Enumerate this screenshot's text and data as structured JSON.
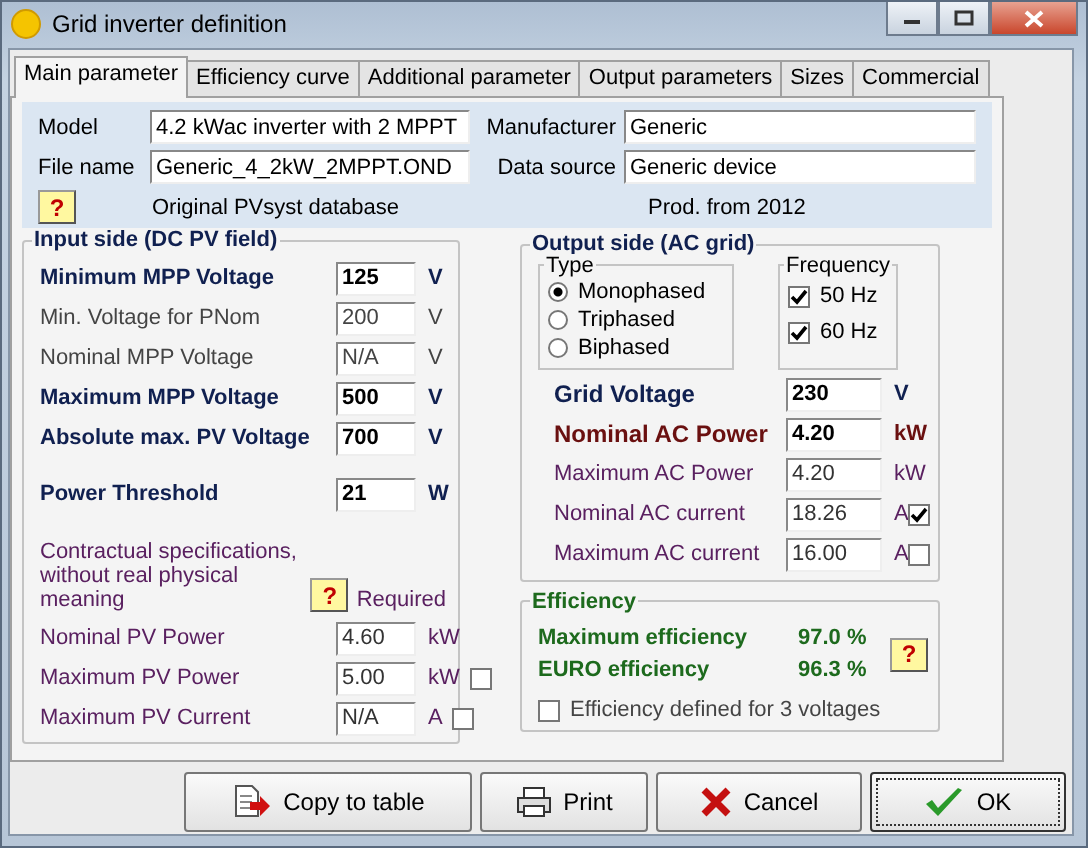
{
  "window": {
    "title": "Grid inverter definition"
  },
  "tabs": [
    {
      "label": "Main parameter",
      "selected": true
    },
    {
      "label": "Efficiency curve",
      "selected": false
    },
    {
      "label": "Additional parameter",
      "selected": false
    },
    {
      "label": "Output parameters",
      "selected": false
    },
    {
      "label": "Sizes",
      "selected": false
    },
    {
      "label": "Commercial",
      "selected": false
    }
  ],
  "general": {
    "left_fields": [
      {
        "label": "Model",
        "value": "4.2 kWac inverter with 2 MPPT"
      },
      {
        "label": "File name",
        "value": "Generic_4_2kW_2MPPT.OND"
      }
    ],
    "right_fields": [
      {
        "label": "Manufacturer",
        "value": "Generic"
      },
      {
        "label": "Data source",
        "value": "Generic device"
      }
    ],
    "help": "?",
    "origin": "Original PVsyst database",
    "production": "Prod. from 2012"
  },
  "input_side": {
    "title": "Input side (DC PV field)",
    "rows": [
      {
        "label": "Minimum MPP Voltage",
        "value": "125",
        "unit": "V",
        "kind": "strong"
      },
      {
        "label": "Min. Voltage for PNom",
        "value": "200",
        "unit": "V",
        "kind": "plain"
      },
      {
        "label": "Nominal  MPP Voltage",
        "value": "N/A",
        "unit": "V",
        "kind": "plain"
      },
      {
        "label": "Maximum MPP Voltage",
        "value": "500",
        "unit": "V",
        "kind": "strong"
      },
      {
        "label": "Absolute max. PV Voltage",
        "value": "700",
        "unit": "V",
        "kind": "strong"
      },
      {
        "label": "Power Threshold",
        "value": "21",
        "unit": "W",
        "kind": "strong"
      }
    ],
    "contract_note": "Contractual specifications,  without real physical meaning",
    "help": "?",
    "required": "Required",
    "contract_rows": [
      {
        "label": "Nominal PV Power",
        "value": "4.60",
        "unit": "kW",
        "kind": "muted"
      },
      {
        "label": "Maximum PV Power",
        "value": "5.00",
        "unit": "kW",
        "kind": "muted",
        "checked": false
      },
      {
        "label": "Maximum PV Current",
        "value": "N/A",
        "unit": "A",
        "kind": "muted",
        "checked": false
      }
    ]
  },
  "output_side": {
    "title": "Output side (AC grid)",
    "type": {
      "title": "Type",
      "options": [
        {
          "label": "Monophased",
          "selected": true
        },
        {
          "label": "Triphased",
          "selected": false
        },
        {
          "label": "Biphased",
          "selected": false
        }
      ]
    },
    "frequency": {
      "title": "Frequency",
      "options": [
        {
          "label": "50 Hz",
          "checked": true
        },
        {
          "label": "60 Hz",
          "checked": true
        }
      ]
    },
    "rows": [
      {
        "label": "Grid Voltage",
        "value": "230",
        "unit": "V",
        "kind": "strong"
      },
      {
        "label": "Nominal AC Power",
        "value": "4.20",
        "unit": "kW",
        "kind": "accent"
      },
      {
        "label": "Maximum AC Power",
        "value": "4.20",
        "unit": "kW",
        "kind": "muted"
      },
      {
        "label": "Nominal AC current",
        "value": "18.26",
        "unit": "A",
        "kind": "muted",
        "checked": true
      },
      {
        "label": "Maximum AC current",
        "value": "16.00",
        "unit": "A",
        "kind": "muted",
        "checked": false
      }
    ]
  },
  "efficiency": {
    "title": "Efficiency",
    "rows": [
      {
        "label": "Maximum efficiency",
        "value": "97.0 %"
      },
      {
        "label": "EURO efficiency",
        "value": "96.3 %"
      }
    ],
    "help": "?",
    "three_voltages": {
      "label": "Efficiency defined for 3 voltages",
      "checked": false
    }
  },
  "buttons": [
    {
      "label": "Copy to table",
      "kind": "copy"
    },
    {
      "label": "Print",
      "kind": "print"
    },
    {
      "label": "Cancel",
      "kind": "cancel"
    },
    {
      "label": "OK",
      "kind": "ok"
    }
  ]
}
